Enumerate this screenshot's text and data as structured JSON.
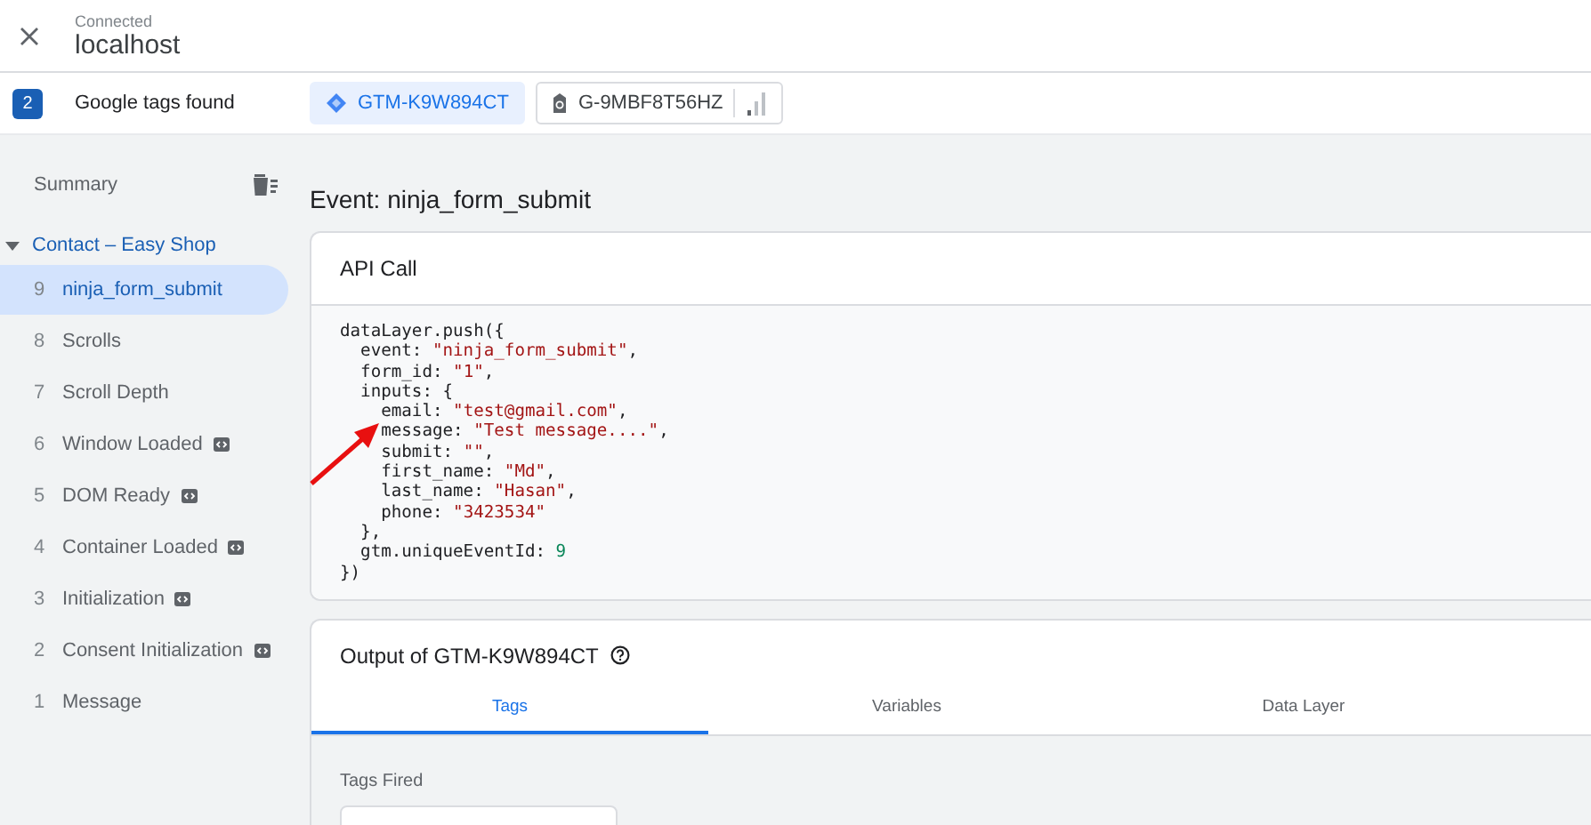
{
  "header": {
    "status": "Connected",
    "host": "localhost"
  },
  "tags_bar": {
    "count": "2",
    "label": "Google tags found",
    "tags": [
      {
        "kind": "gtm",
        "label": "GTM-K9W894CT",
        "selected": true
      },
      {
        "kind": "ga",
        "label": "G-9MBF8T56HZ",
        "selected": false
      }
    ]
  },
  "sidebar": {
    "summary": "Summary",
    "group": {
      "label": "Contact – Easy Shop",
      "expanded": true,
      "items": [
        {
          "number": "9",
          "label": "ninja_form_submit",
          "selected": true,
          "builtin": false
        },
        {
          "number": "8",
          "label": "Scrolls",
          "selected": false,
          "builtin": false
        },
        {
          "number": "7",
          "label": "Scroll Depth",
          "selected": false,
          "builtin": false
        },
        {
          "number": "6",
          "label": "Window Loaded",
          "selected": false,
          "builtin": true
        },
        {
          "number": "5",
          "label": "DOM Ready",
          "selected": false,
          "builtin": true
        },
        {
          "number": "4",
          "label": "Container Loaded",
          "selected": false,
          "builtin": true
        },
        {
          "number": "3",
          "label": "Initialization",
          "selected": false,
          "builtin": true
        },
        {
          "number": "2",
          "label": "Consent Initialization",
          "selected": false,
          "builtin": true
        },
        {
          "number": "1",
          "label": "Message",
          "selected": false,
          "builtin": false
        }
      ]
    }
  },
  "event_title": "Event: ninja_form_submit",
  "api_call": {
    "title": "API Call",
    "code": [
      [
        {
          "kind": "plain",
          "text": "dataLayer.push({"
        }
      ],
      [
        {
          "kind": "plain",
          "text": "  event: "
        },
        {
          "kind": "string",
          "text": "\"ninja_form_submit\""
        },
        {
          "kind": "plain",
          "text": ","
        }
      ],
      [
        {
          "kind": "plain",
          "text": "  form_id: "
        },
        {
          "kind": "string",
          "text": "\"1\""
        },
        {
          "kind": "plain",
          "text": ","
        }
      ],
      [
        {
          "kind": "plain",
          "text": "  inputs: {"
        }
      ],
      [
        {
          "kind": "plain",
          "text": "    email: "
        },
        {
          "kind": "string",
          "text": "\"test@gmail.com\""
        },
        {
          "kind": "plain",
          "text": ","
        }
      ],
      [
        {
          "kind": "plain",
          "text": "    message: "
        },
        {
          "kind": "string",
          "text": "\"Test message....\""
        },
        {
          "kind": "plain",
          "text": ","
        }
      ],
      [
        {
          "kind": "plain",
          "text": "    submit: "
        },
        {
          "kind": "string",
          "text": "\"\""
        },
        {
          "kind": "plain",
          "text": ","
        }
      ],
      [
        {
          "kind": "plain",
          "text": "    first_name: "
        },
        {
          "kind": "string",
          "text": "\"Md\""
        },
        {
          "kind": "plain",
          "text": ","
        }
      ],
      [
        {
          "kind": "plain",
          "text": "    last_name: "
        },
        {
          "kind": "string",
          "text": "\"Hasan\""
        },
        {
          "kind": "plain",
          "text": ","
        }
      ],
      [
        {
          "kind": "plain",
          "text": "    phone: "
        },
        {
          "kind": "string",
          "text": "\"3423534\""
        }
      ],
      [
        {
          "kind": "plain",
          "text": "  },"
        }
      ],
      [
        {
          "kind": "plain",
          "text": "  gtm.uniqueEventId: "
        },
        {
          "kind": "number",
          "text": "9"
        }
      ],
      [
        {
          "kind": "plain",
          "text": "})"
        }
      ]
    ]
  },
  "output": {
    "title": "Output of GTM-K9W894CT",
    "tabs": [
      {
        "label": "Tags",
        "selected": true
      },
      {
        "label": "Variables",
        "selected": false
      },
      {
        "label": "Data Layer",
        "selected": false
      }
    ],
    "section": "Tags Fired"
  }
}
